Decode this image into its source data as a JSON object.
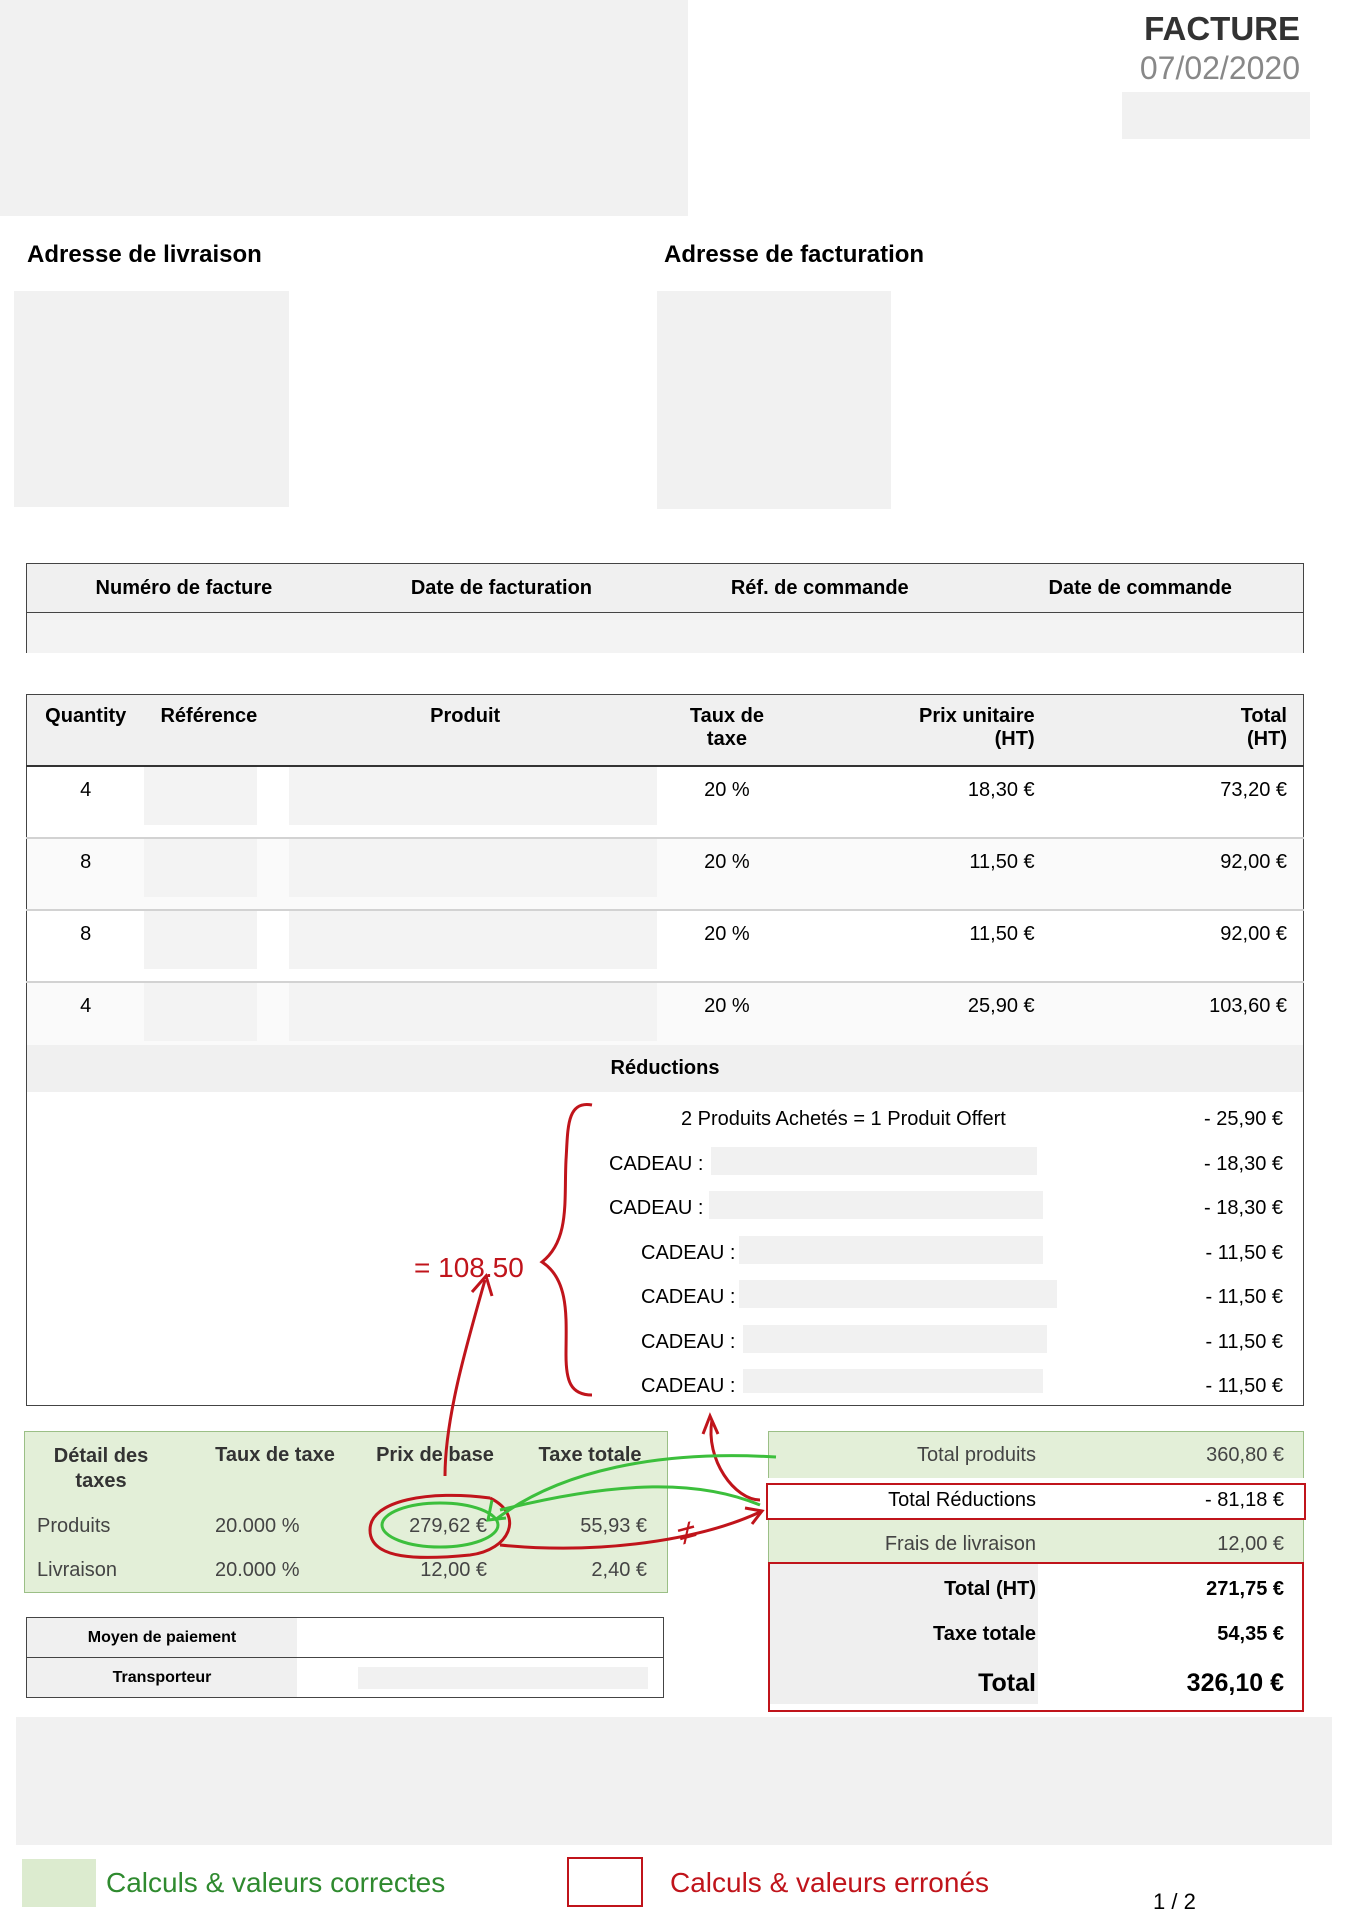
{
  "header": {
    "title": "FACTURE",
    "date": "07/02/2020"
  },
  "addresses": {
    "delivery_label": "Adresse de livraison",
    "billing_label": "Adresse de facturation"
  },
  "invoice_info": {
    "columns": [
      "Numéro de facture",
      "Date de facturation",
      "Réf. de commande",
      "Date de commande"
    ]
  },
  "products": {
    "columns": {
      "quantity": "Quantity",
      "reference": "Référence",
      "product": "Produit",
      "tax_rate": "Taux de\ntaxe",
      "unit_price": "Prix unitaire\n(HT)",
      "total": "Total\n(HT)"
    },
    "rows": [
      {
        "quantity": "4",
        "tax_rate": "20 %",
        "unit_price": "18,30 €",
        "total": "73,20 €"
      },
      {
        "quantity": "8",
        "tax_rate": "20 %",
        "unit_price": "11,50 €",
        "total": "92,00 €"
      },
      {
        "quantity": "8",
        "tax_rate": "20 %",
        "unit_price": "11,50 €",
        "total": "92,00 €"
      },
      {
        "quantity": "4",
        "tax_rate": "20 %",
        "unit_price": "25,90 €",
        "total": "103,60 €"
      }
    ]
  },
  "reductions": {
    "label": "Réductions",
    "rows": [
      {
        "label": "2 Produits Achetés = 1 Produit Offert",
        "amount": "- 25,90 €"
      },
      {
        "label": "CADEAU :",
        "amount": "- 18,30 €"
      },
      {
        "label": "CADEAU :",
        "amount": "- 18,30 €"
      },
      {
        "label": "CADEAU :",
        "amount": "- 11,50 €"
      },
      {
        "label": "CADEAU :",
        "amount": "- 11,50 €"
      },
      {
        "label": "CADEAU :",
        "amount": "- 11,50 €"
      },
      {
        "label": "CADEAU :",
        "amount": "- 11,50 €"
      }
    ]
  },
  "tax_detail": {
    "headers": {
      "detail": "Détail des\ntaxes",
      "rate": "Taux de taxe",
      "base": "Prix de base",
      "total": "Taxe totale"
    },
    "rows": [
      {
        "label": "Produits",
        "rate": "20.000 %",
        "base": "279,62 €",
        "tax": "55,93 €"
      },
      {
        "label": "Livraison",
        "rate": "20.000 %",
        "base": "12,00 €",
        "tax": "2,40 €"
      }
    ]
  },
  "payment": {
    "method_label": "Moyen de paiement",
    "carrier_label": "Transporteur"
  },
  "totals": {
    "products_label": "Total produits",
    "products": "360,80 €",
    "reductions_label": "Total Réductions",
    "reductions": "- 81,18 €",
    "shipping_label": "Frais de livraison",
    "shipping": "12,00 €",
    "ht_label": "Total (HT)",
    "ht": "271,75 €",
    "tax_label": "Taxe totale",
    "tax": "54,35 €",
    "total_label": "Total",
    "total": "326,10 €"
  },
  "annotations": {
    "sum": "= 108.50",
    "neq": "≠"
  },
  "legend": {
    "correct": "Calculs & valeurs correctes",
    "wrong": "Calculs & valeurs erronés"
  },
  "pagination": "1 / 2",
  "colors": {
    "correct_green": "#dcebcf",
    "error_red": "#c0141b",
    "annotation_green": "#3cbf3c"
  }
}
